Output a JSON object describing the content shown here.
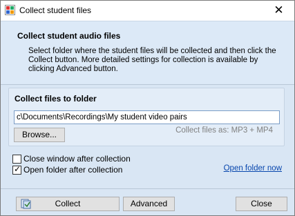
{
  "window": {
    "title": "Collect student files",
    "icon": "app-icon",
    "close_glyph": "✕"
  },
  "header": {
    "title": "Collect student audio files",
    "description": "Select folder where the student files will be collected and then click the Collect button. More detailed settings for collection is available by clicking Advanced button."
  },
  "folder_group": {
    "title": "Collect files to folder",
    "path_value": "c\\Documents\\Recordings\\My student video pairs",
    "browse_label": "Browse...",
    "collect_as_text": "Collect files as: MP3 + MP4"
  },
  "options": {
    "close_window": {
      "label": "Close window after collection",
      "checked": false
    },
    "open_folder": {
      "label": "Open folder after collection",
      "checked": true
    },
    "open_folder_link": "Open folder now"
  },
  "footer": {
    "collect_label": "Collect",
    "advanced_label": "Advanced",
    "close_label": "Close"
  },
  "colors": {
    "accent": "#0645ad",
    "panel": "#d9e6f4",
    "group_bg": "#e3edf8",
    "button_bg": "#e1e1e1"
  }
}
